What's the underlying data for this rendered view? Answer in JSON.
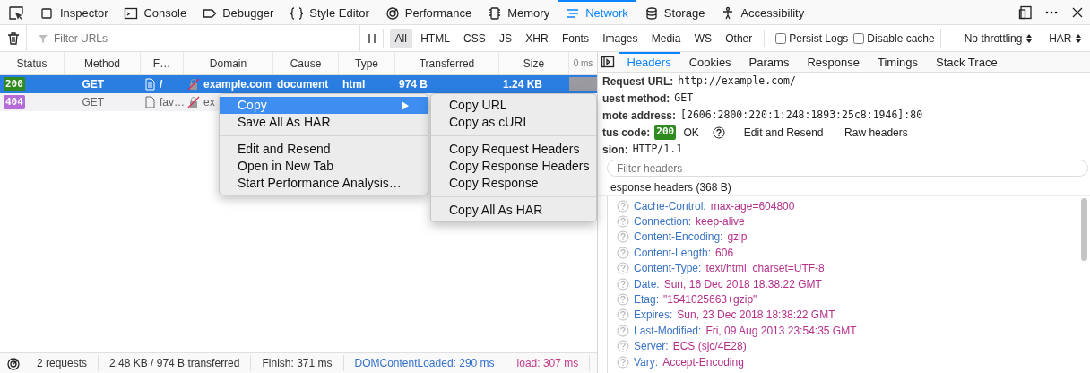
{
  "tabs": [
    {
      "label": "Inspector",
      "selected": false
    },
    {
      "label": "Console",
      "selected": false
    },
    {
      "label": "Debugger",
      "selected": false
    },
    {
      "label": "Style Editor",
      "selected": false
    },
    {
      "label": "Performance",
      "selected": false
    },
    {
      "label": "Memory",
      "selected": false
    },
    {
      "label": "Network",
      "selected": true
    },
    {
      "label": "Storage",
      "selected": false
    },
    {
      "label": "Accessibility",
      "selected": false
    }
  ],
  "filter": {
    "placeholder": "Filter URLs"
  },
  "type_filters": [
    {
      "label": "All",
      "selected": true
    },
    {
      "label": "HTML",
      "selected": false
    },
    {
      "label": "CSS",
      "selected": false
    },
    {
      "label": "JS",
      "selected": false
    },
    {
      "label": "XHR",
      "selected": false
    },
    {
      "label": "Fonts",
      "selected": false
    },
    {
      "label": "Images",
      "selected": false
    },
    {
      "label": "Media",
      "selected": false
    },
    {
      "label": "WS",
      "selected": false
    },
    {
      "label": "Other",
      "selected": false
    }
  ],
  "options": [
    {
      "label": "Persist Logs",
      "checked": false
    },
    {
      "label": "Disable cache",
      "checked": false
    }
  ],
  "throttling": "No throttling",
  "har": "HAR",
  "columns": [
    "Status",
    "Method",
    "F…",
    "Domain",
    "Cause",
    "Type",
    "Transferred",
    "Size",
    "0 ms"
  ],
  "requests": [
    {
      "status": "200",
      "color": "#2f8a1f",
      "method": "GET",
      "file": "/",
      "domain": "example.com",
      "cause": "document",
      "type": "html",
      "transferred": "974 B",
      "size": "1.24 KB",
      "selected": true
    },
    {
      "status": "404",
      "color": "#b56cd8",
      "method": "GET",
      "file": "fav…",
      "domain": "ex",
      "selected": false
    }
  ],
  "context_menu": [
    {
      "kind": "submenu",
      "label": "Copy",
      "selected": true
    },
    {
      "kind": "item",
      "label": "Save All As HAR",
      "selected": false
    },
    {
      "kind": "separator"
    },
    {
      "kind": "item",
      "label": "Edit and Resend",
      "selected": false
    },
    {
      "kind": "item",
      "label": "Open in New Tab",
      "selected": false
    },
    {
      "kind": "item",
      "label": "Start Performance Analysis…",
      "selected": false
    }
  ],
  "submenu": [
    {
      "kind": "item",
      "label": "Copy URL"
    },
    {
      "kind": "item",
      "label": "Copy as cURL"
    },
    {
      "kind": "separator"
    },
    {
      "kind": "item",
      "label": "Copy Request Headers"
    },
    {
      "kind": "item",
      "label": "Copy Response Headers"
    },
    {
      "kind": "item",
      "label": "Copy Response"
    },
    {
      "kind": "separator"
    },
    {
      "kind": "item",
      "label": "Copy All As HAR"
    }
  ],
  "details": {
    "tabs": [
      {
        "label": "Headers",
        "selected": true
      },
      {
        "label": "Cookies",
        "selected": false
      },
      {
        "label": "Params",
        "selected": false
      },
      {
        "label": "Response",
        "selected": false
      },
      {
        "label": "Timings",
        "selected": false
      },
      {
        "label": "Stack Trace",
        "selected": false
      }
    ],
    "summary": [
      {
        "kind": "text",
        "label": "Request URL:",
        "value": "http://example.com/"
      },
      {
        "kind": "text",
        "label": "uest method:",
        "value": "GET"
      },
      {
        "kind": "text",
        "label": "mote address:",
        "value": "[2606:2800:220:1:248:1893:25c8:1946]:80"
      },
      {
        "kind": "status",
        "label": "tus code:",
        "code": "200",
        "value": "OK",
        "actions": [
          "Edit and Resend",
          "Raw headers"
        ]
      },
      {
        "kind": "text",
        "label": "sion:",
        "value": "HTTP/1.1"
      }
    ],
    "filter": {
      "placeholder": "Filter headers"
    },
    "section": "esponse headers (368 B)",
    "headers": [
      {
        "name": "Cache-Control:",
        "value": "max-age=604800"
      },
      {
        "name": "Connection:",
        "value": "keep-alive"
      },
      {
        "name": "Content-Encoding:",
        "value": "gzip"
      },
      {
        "name": "Content-Length:",
        "value": "606"
      },
      {
        "name": "Content-Type:",
        "value": "text/html; charset=UTF-8"
      },
      {
        "name": "Date:",
        "value": "Sun, 16 Dec 2018 18:38:22 GMT"
      },
      {
        "name": "Etag:",
        "value": "\"1541025663+gzip\""
      },
      {
        "name": "Expires:",
        "value": "Sun, 23 Dec 2018 18:38:22 GMT"
      },
      {
        "name": "Last-Modified:",
        "value": "Fri, 09 Aug 2013 23:54:35 GMT"
      },
      {
        "name": "Server:",
        "value": "ECS (sjc/4E28)"
      },
      {
        "name": "Vary:",
        "value": "Accept-Encoding"
      }
    ]
  },
  "status_bar": [
    {
      "text": "2 requests",
      "color": "#333333"
    },
    {
      "text": "2.48 KB / 974 B transferred",
      "color": "#333333"
    },
    {
      "text": "Finish: 371 ms",
      "color": "#333333"
    },
    {
      "text": "DOMContentLoaded: 290 ms",
      "color": "#3370cc"
    },
    {
      "text": "load: 307 ms",
      "color": "#c23a8a"
    }
  ]
}
